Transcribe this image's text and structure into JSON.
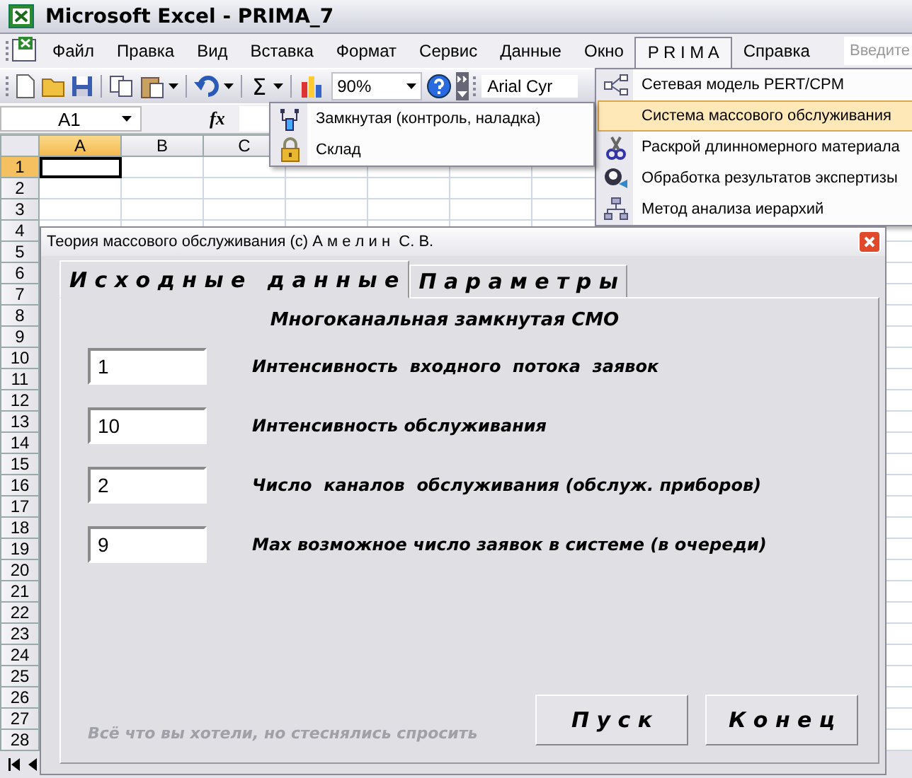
{
  "window": {
    "title": "Microsoft Excel - PRIMA_7"
  },
  "menu_bar": {
    "items": [
      {
        "label": "Файл",
        "selected": false
      },
      {
        "label": "Правка",
        "selected": false
      },
      {
        "label": "Вид",
        "selected": false
      },
      {
        "label": "Вставка",
        "selected": false
      },
      {
        "label": "Формат",
        "selected": false
      },
      {
        "label": "Сервис",
        "selected": false
      },
      {
        "label": "Данные",
        "selected": false
      },
      {
        "label": "Окно",
        "selected": false
      },
      {
        "label": "P R I M A",
        "selected": true
      },
      {
        "label": "Справка",
        "selected": false
      }
    ],
    "help_placeholder": "Введите"
  },
  "toolbar": {
    "sum_symbol": "Σ",
    "zoom": "90%",
    "font": "Arial Cyr"
  },
  "formula_bar": {
    "cell": "A1",
    "function_label": "fx"
  },
  "sheet": {
    "columns": [
      {
        "label": "A",
        "selected": true
      },
      {
        "label": "B",
        "selected": false
      },
      {
        "label": "C",
        "selected": false
      }
    ],
    "rows": [
      {
        "label": "1",
        "selected": true
      },
      {
        "label": "2",
        "selected": false
      },
      {
        "label": "3",
        "selected": false
      },
      {
        "label": "4",
        "selected": false
      },
      {
        "label": "5",
        "selected": false
      },
      {
        "label": "6",
        "selected": false
      },
      {
        "label": "7",
        "selected": false
      },
      {
        "label": "8",
        "selected": false
      },
      {
        "label": "9",
        "selected": false
      },
      {
        "label": "10",
        "selected": false
      },
      {
        "label": "11",
        "selected": false
      },
      {
        "label": "12",
        "selected": false
      },
      {
        "label": "13",
        "selected": false
      },
      {
        "label": "14",
        "selected": false
      },
      {
        "label": "15",
        "selected": false
      },
      {
        "label": "16",
        "selected": false
      },
      {
        "label": "17",
        "selected": false
      },
      {
        "label": "18",
        "selected": false
      },
      {
        "label": "19",
        "selected": false
      },
      {
        "label": "20",
        "selected": false
      },
      {
        "label": "21",
        "selected": false
      },
      {
        "label": "22",
        "selected": false
      },
      {
        "label": "23",
        "selected": false
      },
      {
        "label": "24",
        "selected": false
      },
      {
        "label": "25",
        "selected": false
      },
      {
        "label": "26",
        "selected": false
      },
      {
        "label": "27",
        "selected": false
      },
      {
        "label": "28",
        "selected": false
      }
    ]
  },
  "submenu": {
    "items": [
      {
        "label": "Замкнутая (контроль, наладка)",
        "kind": "queue"
      },
      {
        "label": "Склад",
        "kind": "lock"
      }
    ]
  },
  "prima_menu": {
    "items": [
      {
        "label": "Сетевая модель PERT/CPM",
        "kind": "network",
        "selected": false
      },
      {
        "label": "Система массового обслуживания",
        "kind": "none",
        "selected": true
      },
      {
        "label": "Раскрой длинномерного материала",
        "kind": "scissors",
        "selected": false
      },
      {
        "label": "Обработка результатов экспертизы",
        "kind": "experts",
        "selected": false
      },
      {
        "label": "Метод анализа иерархий",
        "kind": "hierarchy",
        "selected": false
      }
    ]
  },
  "dialog": {
    "title": "Теория массового обслуживания (с) А м е л и н  С. В.",
    "tabs": [
      {
        "label": "И с х о д н ы е   д а н н ы е",
        "selected": true
      },
      {
        "label": "П а р а м е т р ы",
        "selected": false
      }
    ],
    "heading": "Многоканальная замкнутая СМО",
    "fields": [
      {
        "value": "1",
        "label": "Интенсивность  входного  потока  заявок"
      },
      {
        "value": "10",
        "label": "Интенсивность обслуживания"
      },
      {
        "value": "2",
        "label": "Число  каналов  обслуживания (обслуж. приборов)"
      },
      {
        "value": "9",
        "label": "Мах возможное число заявок в системе (в очереди)"
      }
    ],
    "hint": "Всё что вы хотели, но стеснялись спросить",
    "buttons": [
      "П у с к",
      "К о н е ц"
    ]
  }
}
